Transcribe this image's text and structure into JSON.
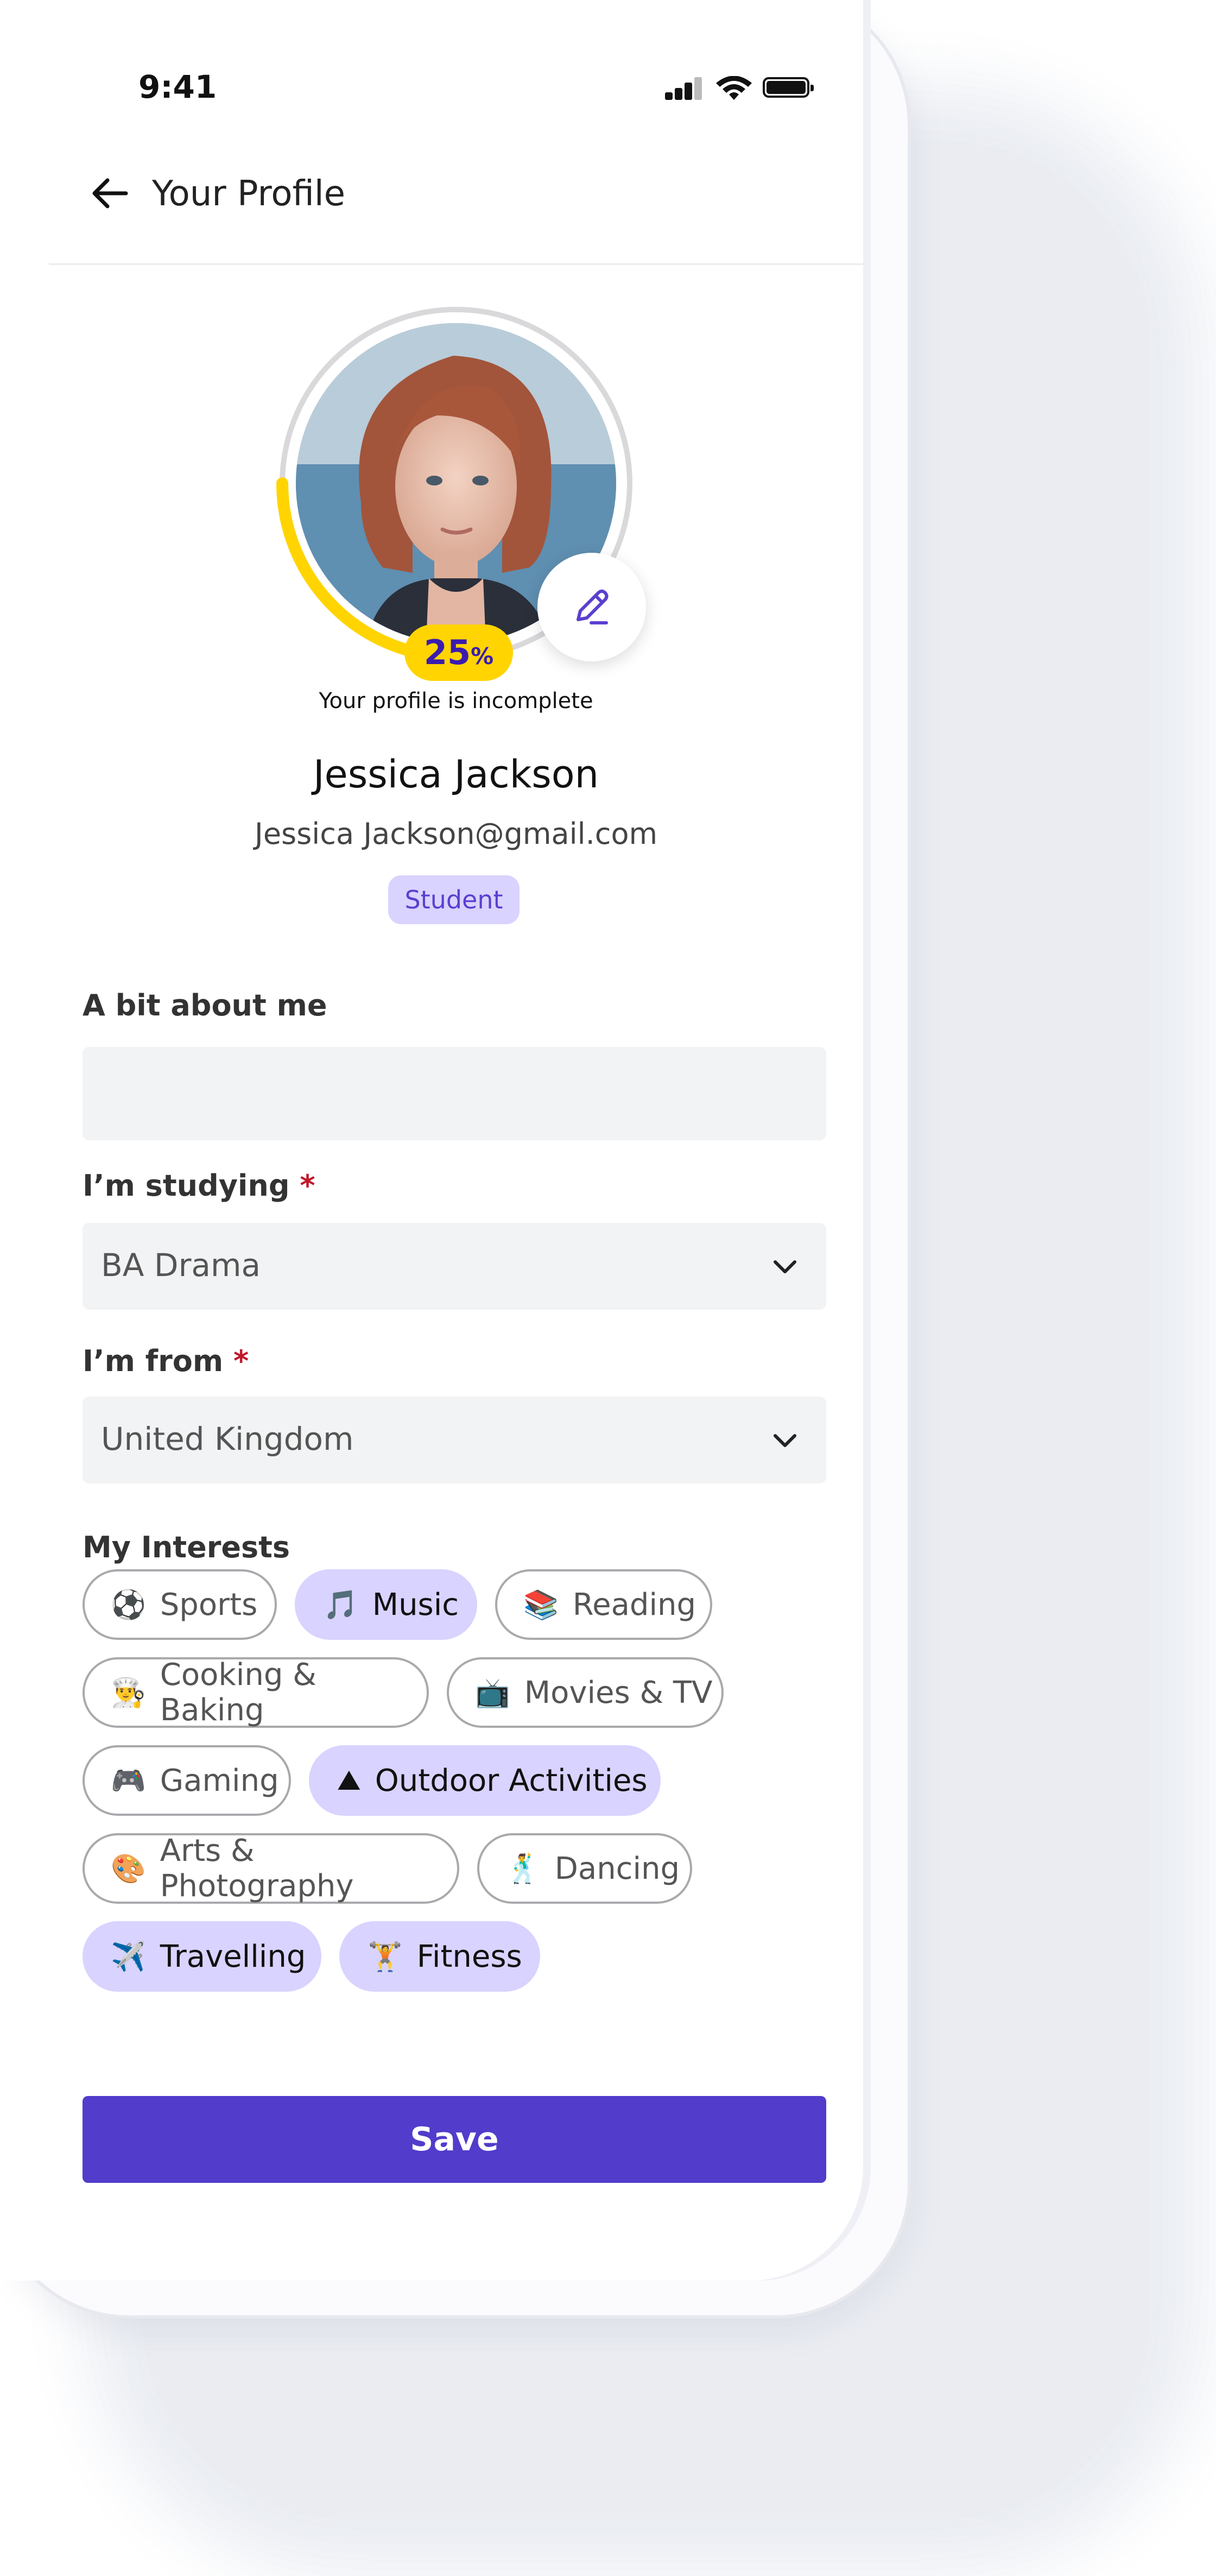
{
  "status_bar": {
    "time": "9:41"
  },
  "header": {
    "title": "Your Profile"
  },
  "profile": {
    "completion_percent": 25,
    "percent_value": "25",
    "percent_sign": "%",
    "completion_text": "Your profile is incomplete",
    "name": "Jessica Jackson",
    "email": "Jessica Jackson@gmail.com",
    "role": "Student"
  },
  "form": {
    "about_label": "A bit about me",
    "about_value": "",
    "studying_label": "I’m studying",
    "studying_value": "BA Drama",
    "from_label": "I’m from",
    "from_value": "United Kingdom",
    "required_mark": "*"
  },
  "interests": {
    "title": "My Interests",
    "items": [
      {
        "emoji": "⚽",
        "label": "Sports",
        "selected": false
      },
      {
        "emoji": "🎵",
        "label": "Music",
        "selected": true
      },
      {
        "emoji": "📚",
        "label": "Reading",
        "selected": false
      },
      {
        "emoji": "👨‍🍳",
        "label": "Cooking & Baking",
        "selected": false
      },
      {
        "emoji": "📺",
        "label": "Movies & TV",
        "selected": false
      },
      {
        "emoji": "🎮",
        "label": "Gaming",
        "selected": false
      },
      {
        "emoji": "⛰",
        "label": "Outdoor Activities",
        "selected": true
      },
      {
        "emoji": "🎨",
        "label": "Arts & Photography",
        "selected": false
      },
      {
        "emoji": "🕺",
        "label": "Dancing",
        "selected": false
      },
      {
        "emoji": "✈️",
        "label": "Travelling",
        "selected": true
      },
      {
        "emoji": "🏋",
        "label": "Fitness",
        "selected": true
      }
    ]
  },
  "actions": {
    "save_label": "Save"
  },
  "colors": {
    "accent": "#513ccb",
    "chip_selected": "#d9d3ff",
    "progress": "#ffd400"
  }
}
